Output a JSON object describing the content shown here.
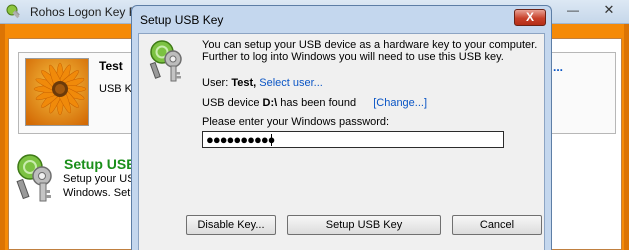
{
  "main_window": {
    "title": "Rohos Logon Key FR",
    "minimize_label": "—",
    "close_label": "✕",
    "user": {
      "name": "Test",
      "key_info": "USB Ke"
    },
    "dots_link": "...",
    "setup": {
      "heading": "Setup USB",
      "desc_line1": "Setup your USB",
      "desc_line2": "Windows. Setu"
    },
    "colors": {
      "accent_orange": "#f58a07",
      "heading_green": "#1a8f1a"
    }
  },
  "dialog": {
    "title": "Setup USB Key",
    "close_label": "X",
    "intro_line1": "You can setup your USB device as a hardware key to your computer.",
    "intro_line2": "Further to log into Windows you will need to use this USB key.",
    "user_prefix": "User:",
    "user_name": "Test,",
    "select_user_link": "Select user...",
    "device_prefix": "USB device",
    "device_path": "D:\\",
    "device_status": "has been found",
    "change_link": "[Change...]",
    "password_label": "Please enter your Windows password:",
    "password_value": "●●●●●●●●●●",
    "buttons": {
      "disable_key": "Disable Key...",
      "setup_usb_key": "Setup USB Key",
      "cancel": "Cancel"
    },
    "colors": {
      "link_blue": "#0a55c5",
      "close_red": "#c8412b"
    }
  },
  "icons": {
    "app_icon": "rohos-key-icon",
    "user_photo": "orange-gerbera-flower",
    "setup_icon": "usb-key-with-green-badge",
    "dialog_icon": "usb-key-with-green-badge"
  }
}
